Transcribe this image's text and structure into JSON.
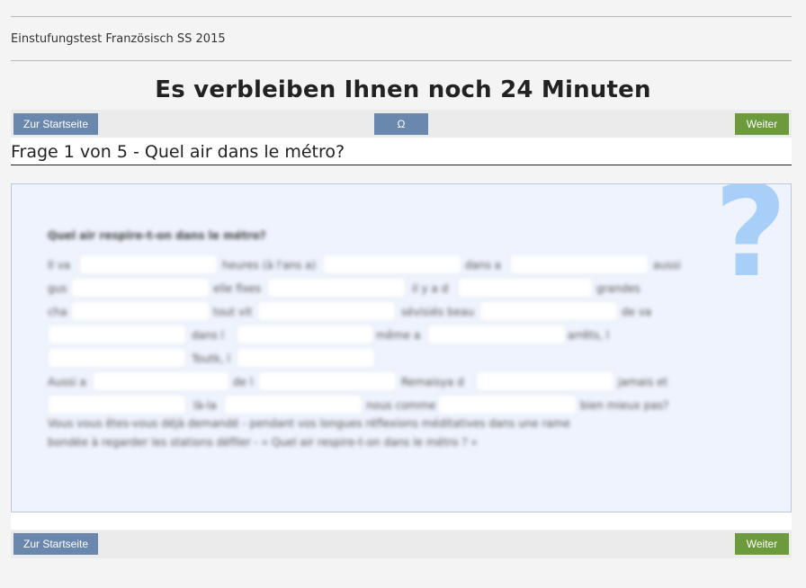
{
  "header": {
    "test_title": "Einstufungstest Französisch SS 2015",
    "timer_text": "Es verbleiben Ihnen noch 24 Minuten"
  },
  "toolbar_top": {
    "start_label": "Zur Startseite",
    "omega_label": "Ω",
    "next_label": "Weiter"
  },
  "question": {
    "heading": "Frage 1 von 5 - Quel air dans le métro?",
    "prompt": "Quel air respire-t-on dans le métro?",
    "words": [
      "Il va",
      "heures (à l'ans a)",
      "dans a",
      "aussi",
      "gus",
      "elle fixes",
      "il y a d",
      "grandes",
      "cha",
      "tout vit",
      "sévisiés beau",
      "de va",
      "dans l",
      "même a",
      "arrêts, l",
      "Toutk, l",
      "Aussi a",
      "de l",
      "Remaisya d",
      "jamais et",
      "là-la",
      "nous comme",
      "bien mieux pas?"
    ],
    "closing_1": "Vous vous êtes-vous déjà demandé - pendant vos longues réflexions méditatives dans une rame",
    "closing_2": "bondée à regarder les stations défiler - « Quel air respire-t-on dans le métro ? »",
    "icon": "question-mark-icon"
  },
  "toolbar_bottom": {
    "start_label": "Zur Startseite",
    "next_label": "Weiter"
  },
  "colors": {
    "button_blue": "#6a87ad",
    "button_green": "#6c9a3c",
    "panel_bg": "#eef3fd",
    "question_mark": "#a8cff7"
  }
}
